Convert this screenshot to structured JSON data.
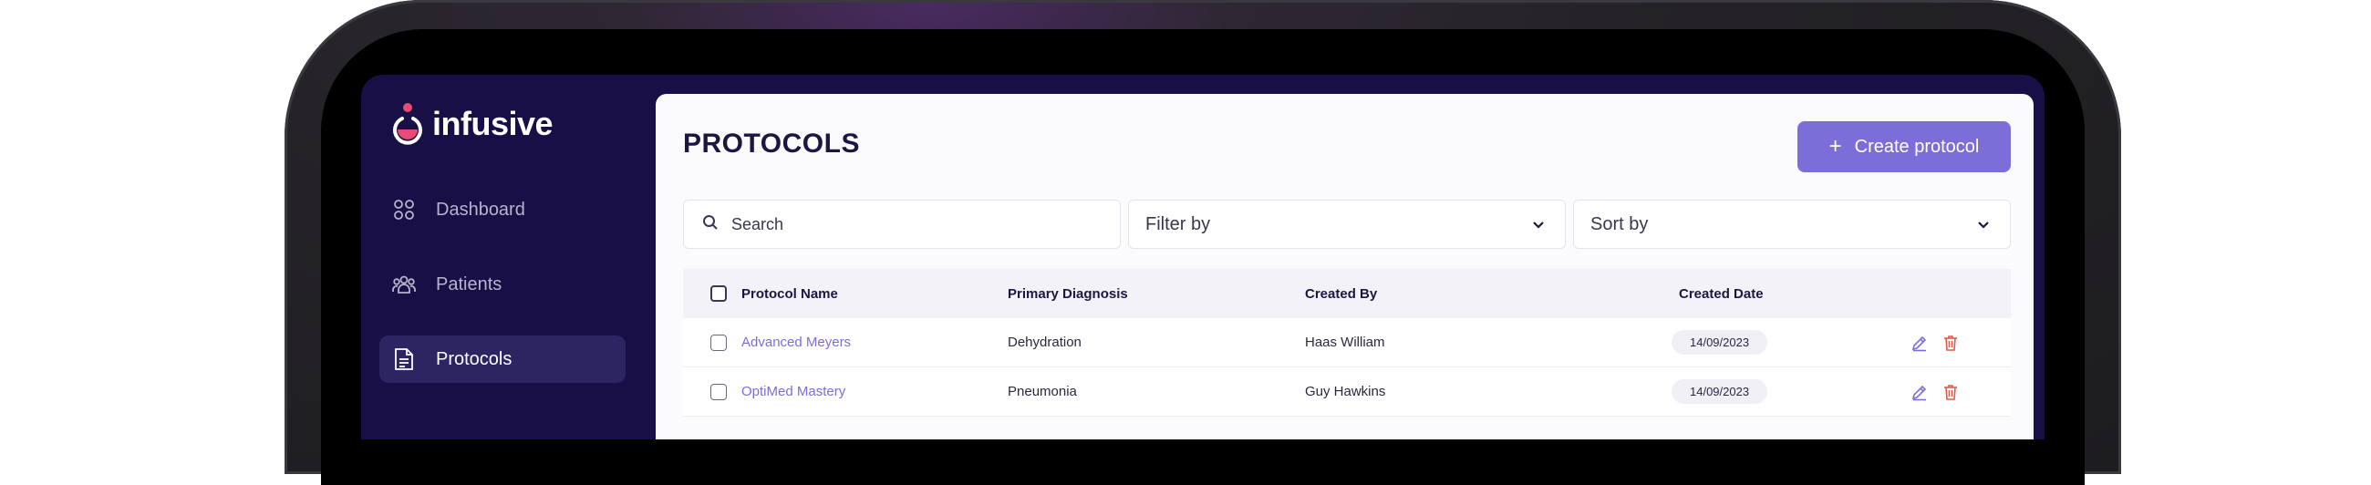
{
  "app": {
    "name": "infusive"
  },
  "nav": [
    {
      "label": "Dashboard",
      "icon": "grid-icon",
      "active": false
    },
    {
      "label": "Patients",
      "icon": "users-icon",
      "active": false
    },
    {
      "label": "Protocols",
      "icon": "document-icon",
      "active": true
    }
  ],
  "page": {
    "title": "PROTOCOLS",
    "create_label": "Create protocol"
  },
  "search": {
    "placeholder": "Search"
  },
  "filter": {
    "label": "Filter by"
  },
  "sort": {
    "label": "Sort by"
  },
  "table": {
    "columns": [
      "Protocol Name",
      "Primary Diagnosis",
      "Created By",
      "Created Date"
    ],
    "rows": [
      {
        "name": "Advanced Meyers",
        "diagnosis": "Dehydration",
        "created_by": "Haas William",
        "date": "14/09/2023"
      },
      {
        "name": "OptiMed Mastery",
        "diagnosis": "Pneumonia",
        "created_by": "Guy Hawkins",
        "date": "14/09/2023"
      }
    ]
  },
  "colors": {
    "sidebar_bg": "#170f45",
    "accent": "#7b6ed9",
    "logo_pink": "#ea4a72",
    "delete_red": "#e05a4a"
  }
}
